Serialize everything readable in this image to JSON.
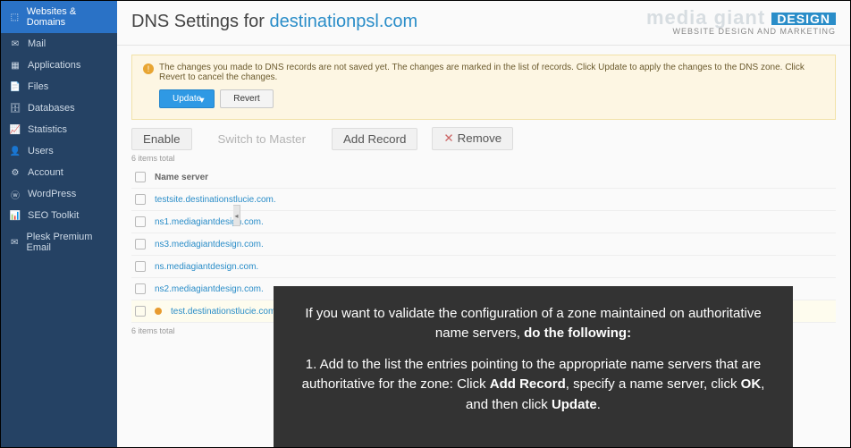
{
  "sidebar": {
    "items": [
      {
        "icon": "⬚",
        "label": "Websites & Domains",
        "name": "nav-websites-domains",
        "active": true
      },
      {
        "icon": "✉",
        "label": "Mail",
        "name": "nav-mail"
      },
      {
        "icon": "▦",
        "label": "Applications",
        "name": "nav-applications"
      },
      {
        "icon": "📄",
        "label": "Files",
        "name": "nav-files"
      },
      {
        "icon": "🗄",
        "label": "Databases",
        "name": "nav-databases"
      },
      {
        "icon": "📈",
        "label": "Statistics",
        "name": "nav-statistics"
      },
      {
        "icon": "👤",
        "label": "Users",
        "name": "nav-users"
      },
      {
        "icon": "⚙",
        "label": "Account",
        "name": "nav-account"
      },
      {
        "icon": "ⓦ",
        "label": "WordPress",
        "name": "nav-wordpress"
      },
      {
        "icon": "📊",
        "label": "SEO Toolkit",
        "name": "nav-seo-toolkit"
      },
      {
        "icon": "✉",
        "label": "Plesk Premium Email",
        "name": "nav-premium-email"
      }
    ]
  },
  "header": {
    "title_prefix": "DNS Settings for ",
    "domain": "destinationpsl.com",
    "brand_line1": "media giant",
    "brand_badge": "DESIGN",
    "brand_line2": "WEBSITE DESIGN AND MARKETING"
  },
  "notice": {
    "message": "The changes you made to DNS records are not saved yet. The changes are marked in the list of records. Click Update to apply the changes to the DNS zone. Click Revert to cancel the changes.",
    "update_label": "Update",
    "revert_label": "Revert"
  },
  "toolbar": {
    "enable": "Enable",
    "switch": "Switch to Master",
    "add": "Add Record",
    "remove": "Remove"
  },
  "records": {
    "count_top": "6 items total",
    "count_bottom": "6 items total",
    "col_name": "Name server",
    "rows": [
      {
        "host": "testsite.destinationstlucie.com.",
        "new": false
      },
      {
        "host": "ns1.mediagiantdesign.com.",
        "new": false
      },
      {
        "host": "ns3.mediagiantdesign.com.",
        "new": false
      },
      {
        "host": "ns.mediagiantdesign.com.",
        "new": false
      },
      {
        "host": "ns2.mediagiantdesign.com.",
        "new": false
      },
      {
        "host": "test.destinationstlucie.com.",
        "new": true
      }
    ]
  },
  "overlay": {
    "p1a": "If you want to validate the configuration of a zone maintained on authoritative name servers, ",
    "p1b": "do the following:",
    "p2a": "1. Add to the list the entries pointing to the appropriate name servers that are authoritative for the zone: Click ",
    "p2b": "Add Record",
    "p2c": ", specify a name server, click ",
    "p2d": "OK",
    "p2e": ", and then click ",
    "p2f": "Update",
    "p2g": "."
  }
}
